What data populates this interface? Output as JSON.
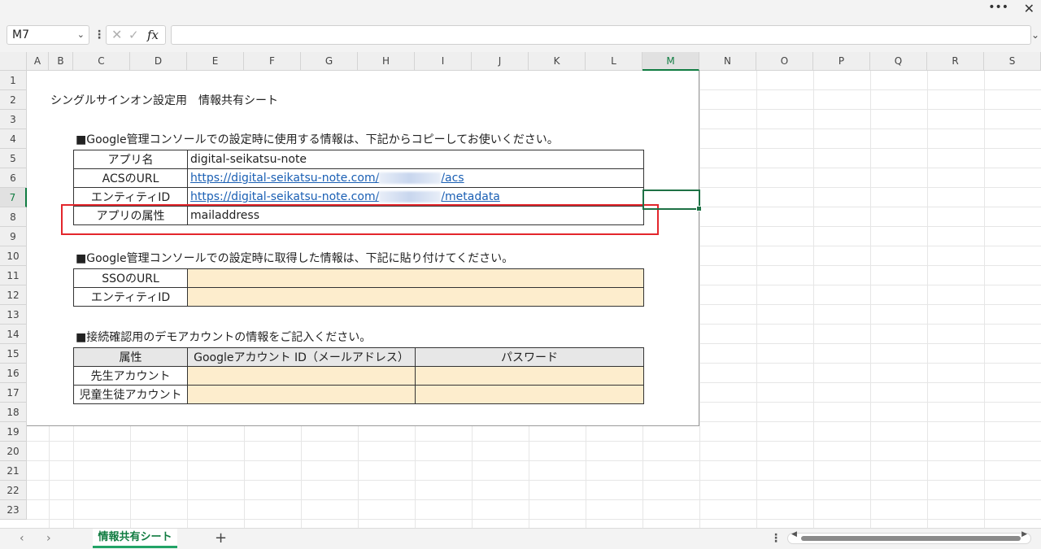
{
  "window": {
    "more_icon": "ellipsis-icon",
    "close_icon": "close-icon"
  },
  "formula_bar": {
    "name_box": "M7",
    "fx_label": "fx",
    "formula": ""
  },
  "columns": [
    "A",
    "B",
    "C",
    "D",
    "E",
    "F",
    "G",
    "H",
    "I",
    "J",
    "K",
    "L",
    "M",
    "N",
    "O",
    "P",
    "Q",
    "R",
    "S"
  ],
  "rows": [
    "1",
    "2",
    "3",
    "4",
    "5",
    "6",
    "7",
    "8",
    "9",
    "10",
    "11",
    "12",
    "13",
    "14",
    "15",
    "16",
    "17",
    "18",
    "19",
    "20",
    "21",
    "22",
    "23"
  ],
  "selected_cell": "M7",
  "sheet": {
    "title": "シングルサインオン設定用　情報共有シート",
    "section1": "■Google管理コンソールでの設定時に使用する情報は、下記からコピーしてお使いください。",
    "table1": [
      {
        "label": "アプリ名",
        "value": "digital-seikatsu-note"
      },
      {
        "label": "ACSのURL",
        "value_pre": "https://digital-seikatsu-note.com/",
        "value_post": "/acs"
      },
      {
        "label": "エンティティID",
        "value_pre": "https://digital-seikatsu-note.com/",
        "value_post": "/metadata"
      },
      {
        "label": "アプリの属性",
        "value": "mailaddress"
      }
    ],
    "section2": "■Google管理コンソールでの設定時に取得した情報は、下記に貼り付けてください。",
    "table2": [
      {
        "label": "SSOのURL",
        "value": ""
      },
      {
        "label": "エンティティID",
        "value": ""
      }
    ],
    "section3": "■接続確認用のデモアカウントの情報をご記入ください。",
    "table3": {
      "headers": [
        "属性",
        "Googleアカウント ID（メールアドレス）",
        "パスワード"
      ],
      "rows": [
        {
          "label": "先生アカウント",
          "account": "",
          "password": ""
        },
        {
          "label": "児童生徒アカウント",
          "account": "",
          "password": ""
        }
      ]
    }
  },
  "sheet_tabs": {
    "active": "情報共有シート",
    "add": "+",
    "prev": "‹",
    "next": "›"
  },
  "colors": {
    "accent": "#107c41",
    "input_fill": "#fdedcd",
    "highlight_box": "#e3262c",
    "link": "#1a5fb4"
  }
}
